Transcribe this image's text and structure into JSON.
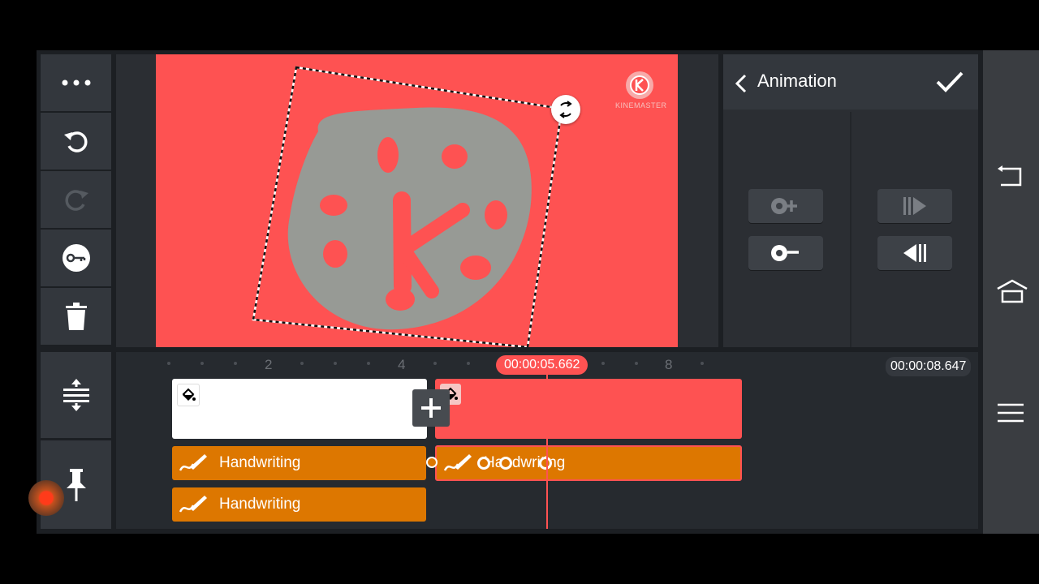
{
  "panel": {
    "title": "Animation",
    "back_icon": "chevron-left-icon",
    "confirm_icon": "checkmark-icon",
    "buttons": [
      {
        "name": "add-keyframe-button",
        "icon": "keyframe-add-icon"
      },
      {
        "name": "play-forward-button",
        "icon": "play-forward-icon"
      },
      {
        "name": "remove-keyframe-button",
        "icon": "keyframe-remove-icon"
      },
      {
        "name": "play-backward-button",
        "icon": "play-backward-icon"
      }
    ]
  },
  "left_toolbar": {
    "top": [
      "more-icon",
      "undo-icon",
      "redo-icon",
      "key-icon",
      "trash-icon"
    ],
    "bottom": [
      "expand-tracks-icon",
      "pin-icon"
    ]
  },
  "preview": {
    "watermark": "KINEMASTER",
    "canvas_color": "#fe5252",
    "drawing_color": "#979a95"
  },
  "timeline": {
    "ruler_labels": [
      "2",
      "4",
      "8"
    ],
    "playhead_time": "00:00:05.662",
    "total_time": "00:00:08.647",
    "clips": [
      {
        "name": "white-clip",
        "color": "#ffffff"
      },
      {
        "name": "red-clip",
        "color": "#fe5252"
      }
    ],
    "layers": [
      {
        "label": "Handwriting"
      },
      {
        "label": "Handwriting"
      },
      {
        "label": "Handwriting"
      }
    ],
    "add_icon": "plus-icon"
  },
  "nav": [
    "back-icon",
    "home-icon",
    "menu-icon"
  ],
  "colors": {
    "accent": "#fe5252",
    "layer": "#dd7700",
    "panel": "#33373d"
  }
}
